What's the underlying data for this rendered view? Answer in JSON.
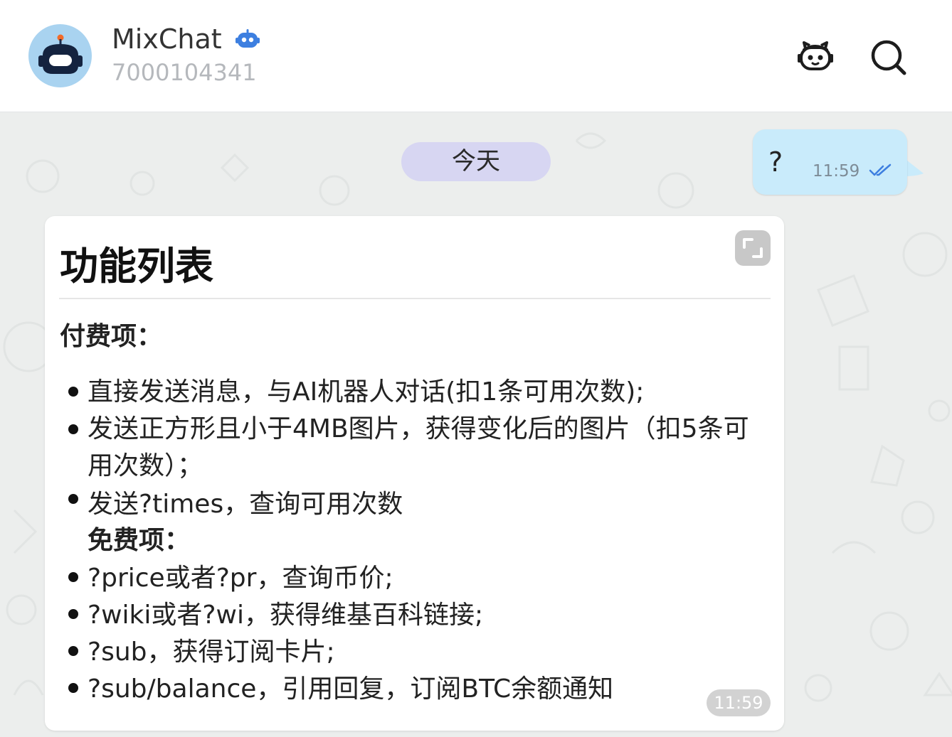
{
  "header": {
    "name": "MixChat",
    "id": "7000104341",
    "verified_badge": "bot-badge-icon",
    "actions": [
      "bot-icon",
      "search-icon"
    ]
  },
  "chat": {
    "date_label": "今天",
    "outgoing": {
      "text": "?",
      "time": "11:59",
      "status": "read-double-check"
    },
    "incoming": {
      "title": "功能列表",
      "paid_heading": "付费项：",
      "paid_items": [
        "直接发送消息，与AI机器人对话(扣1条可用次数);",
        "发送正方形且小于4MB图片，获得变化后的图片（扣5条可用次数）；",
        "发送?times，查询可用次数"
      ],
      "free_heading": "免费项：",
      "free_items": [
        "?price或者?pr，查询币价;",
        "?wiki或者?wi，获得维基百科链接;",
        "?sub，获得订阅卡片;",
        "?sub/balance，引用回复，订阅BTC余额通知"
      ],
      "time": "11:59"
    }
  },
  "colors": {
    "chat_background": "#eceeed",
    "outgoing_bubble": "#c9ebfb",
    "date_pill": "#d7d6f2",
    "avatar_bg": "#a9d3f0",
    "accent_blue": "#3d7fe0"
  }
}
